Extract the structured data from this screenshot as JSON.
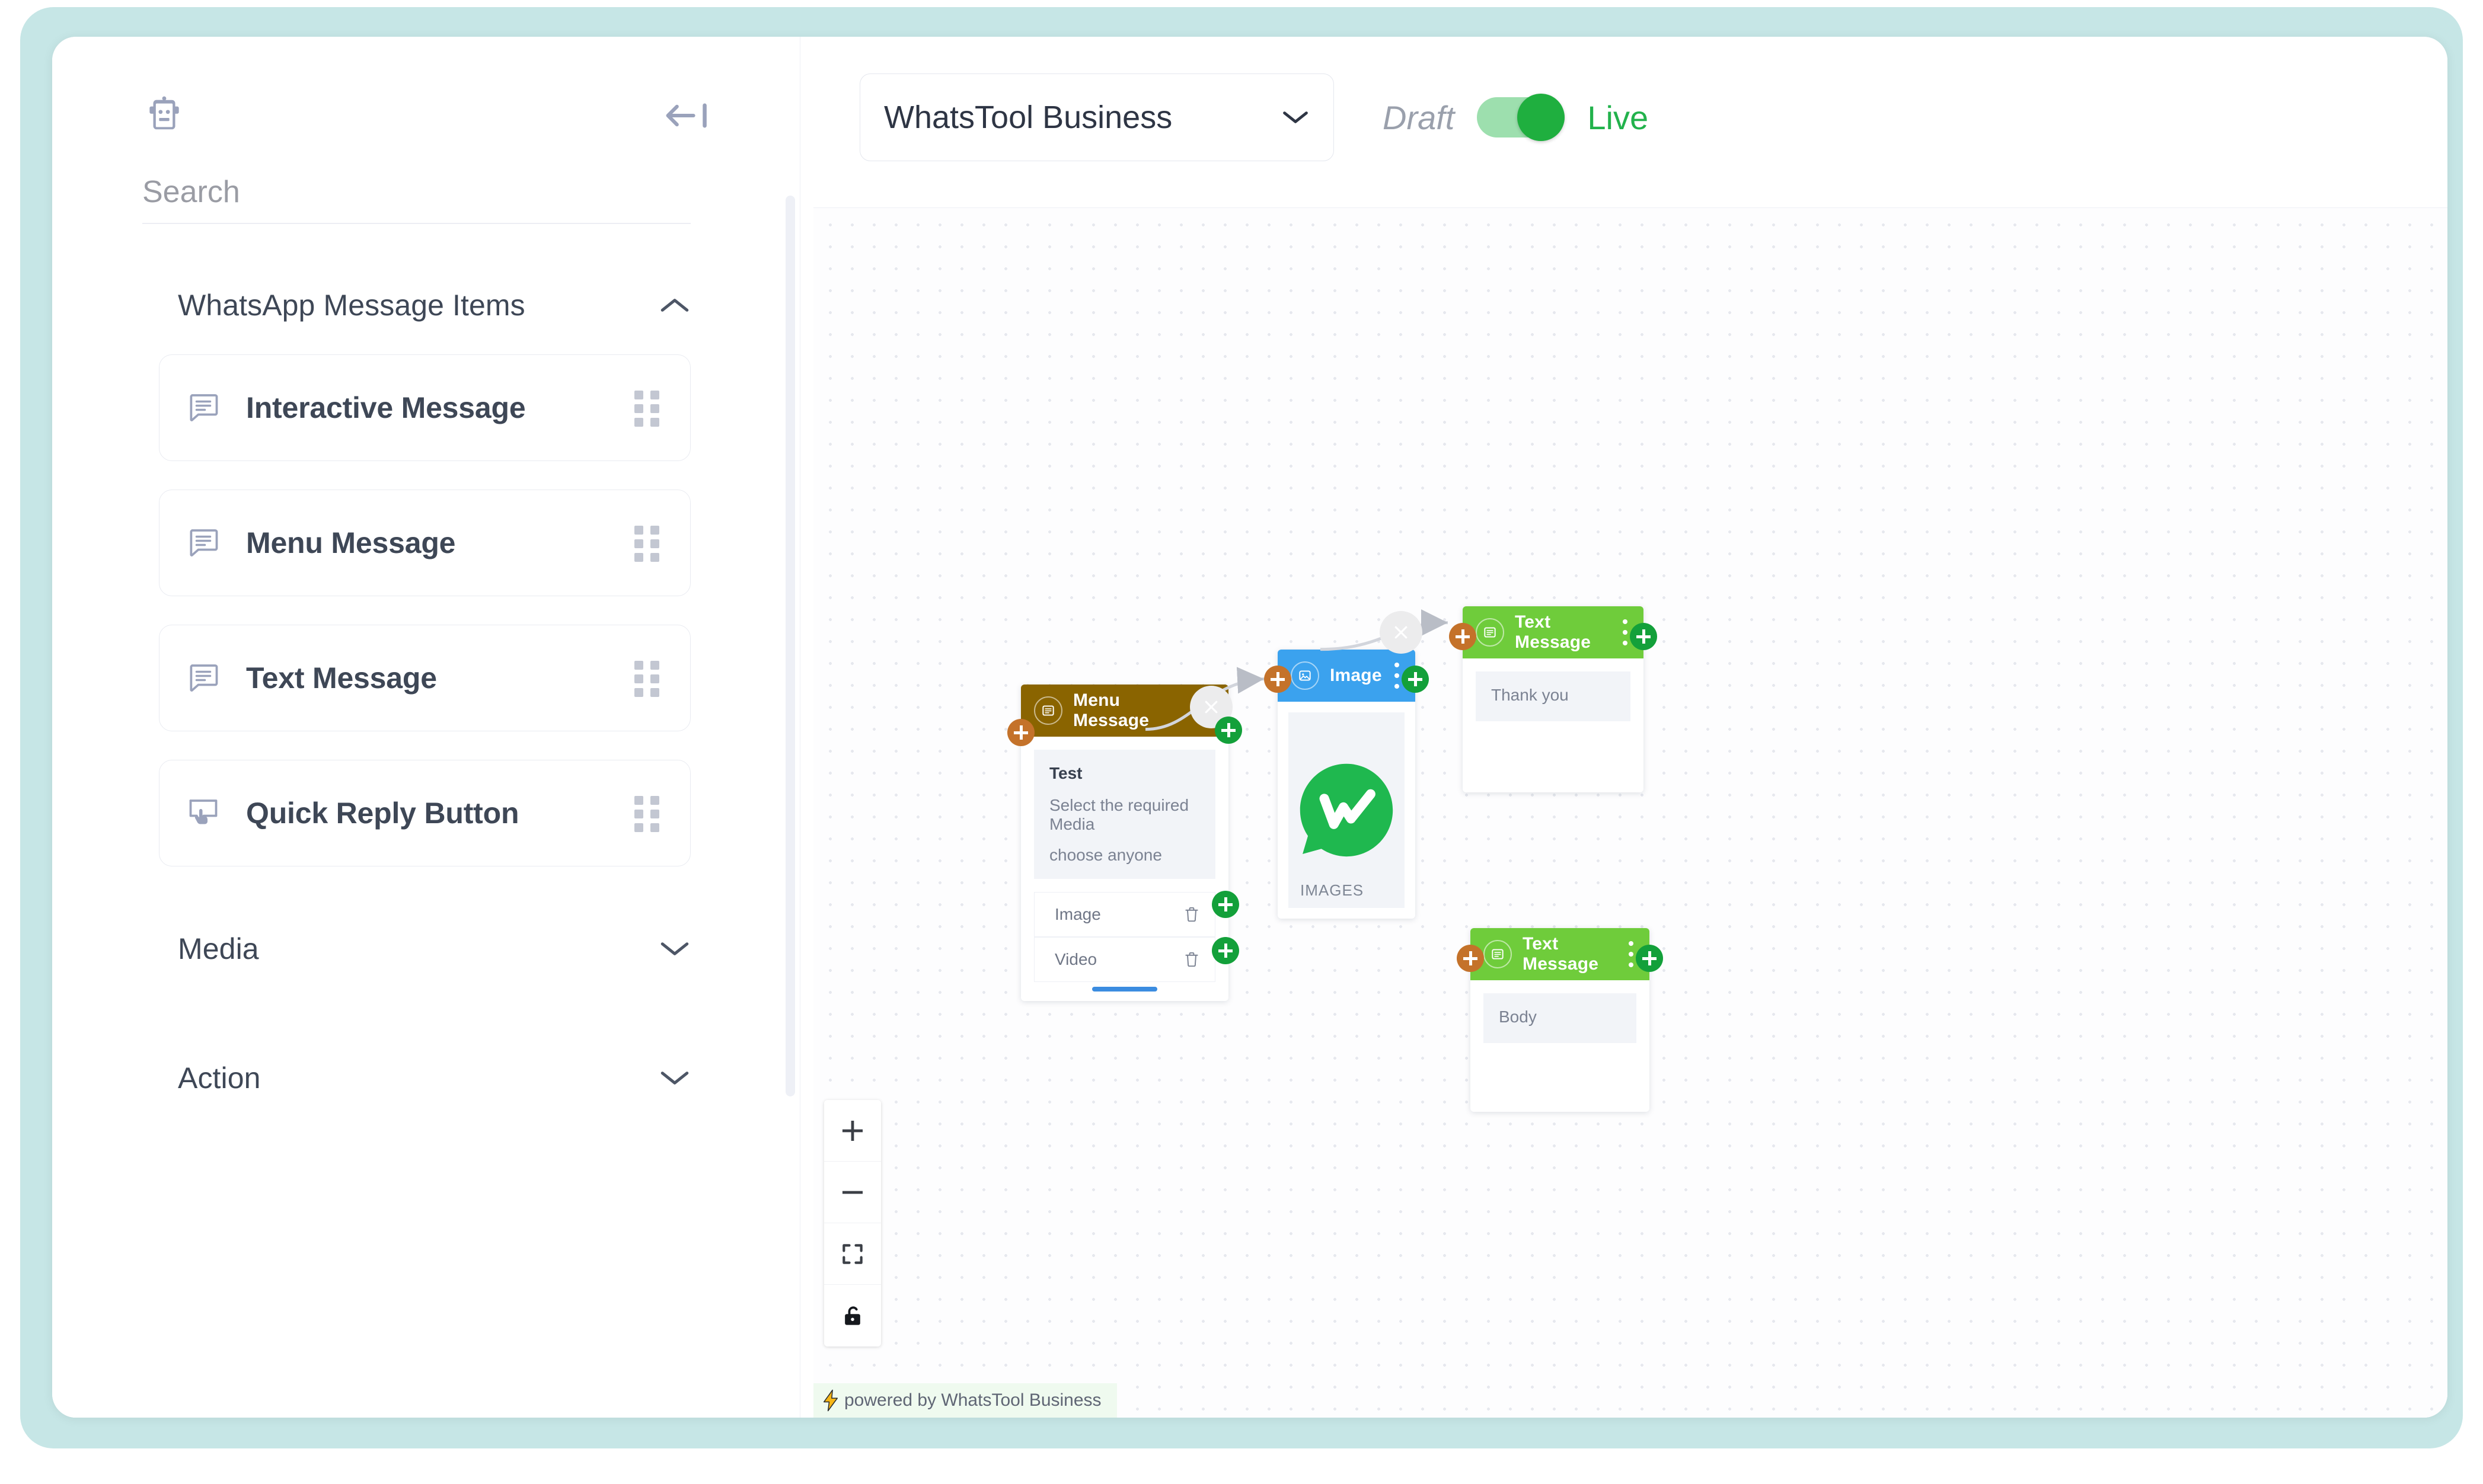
{
  "sidebar": {
    "bot_icon": "robot-icon",
    "collapse_icon": "collapse-panel-icon",
    "search": {
      "placeholder": "Search",
      "value": ""
    },
    "sections": [
      {
        "title": "WhatsApp Message Items",
        "expanded": true,
        "chevron": "chevron-up-icon",
        "items": [
          {
            "label": "Interactive Message",
            "icon": "chat-lines-icon",
            "drag_handle": "drag-grip-icon"
          },
          {
            "label": "Menu Message",
            "icon": "chat-lines-icon",
            "drag_handle": "drag-grip-icon"
          },
          {
            "label": "Text Message",
            "icon": "chat-lines-icon",
            "drag_handle": "drag-grip-icon"
          },
          {
            "label": "Quick Reply Button",
            "icon": "cursor-click-icon",
            "drag_handle": "drag-grip-icon"
          }
        ]
      },
      {
        "title": "Media",
        "expanded": false,
        "chevron": "chevron-down-icon",
        "items": []
      },
      {
        "title": "Action",
        "expanded": false,
        "chevron": "chevron-down-icon",
        "items": []
      }
    ]
  },
  "topbar": {
    "flow_select": {
      "value": "WhatsTool Business",
      "chevron": "chevron-down-icon"
    },
    "status_toggle": {
      "left_label": "Draft",
      "right_label": "Live",
      "state": "Live",
      "on_color": "#1faf3f",
      "track_color": "#9ddfae"
    }
  },
  "canvas": {
    "nodes": [
      {
        "id": "menu-message",
        "title": "Menu Message",
        "header_color": "#8a6400",
        "icon": "menu-message-icon",
        "kebab": "kebab-menu-icon",
        "body": {
          "heading": "Test",
          "lines": [
            "Select the required Media",
            "choose anyone"
          ]
        },
        "options": [
          {
            "label": "Image",
            "delete_icon": "trash-icon"
          },
          {
            "label": "Video",
            "delete_icon": "trash-icon"
          }
        ]
      },
      {
        "id": "image",
        "title": "Image",
        "header_color": "#3ba2ee",
        "icon": "image-icon",
        "kebab": "kebab-menu-icon",
        "preview_logo": "whatstool-logo",
        "caption": "IMAGES"
      },
      {
        "id": "text-message-1",
        "title": "Text Message",
        "header_color": "#6fcc3b",
        "icon": "text-message-icon",
        "kebab": "kebab-menu-icon",
        "body_text": "Thank you"
      },
      {
        "id": "text-message-2",
        "title": "Text Message",
        "header_color": "#6fcc3b",
        "icon": "text-message-icon",
        "kebab": "kebab-menu-icon",
        "body_text": "Body"
      }
    ],
    "edges": [
      {
        "from": "menu-message",
        "to": "image",
        "delete_icon": "edge-delete-icon"
      },
      {
        "from": "image",
        "to": "text-message-1",
        "delete_icon": "edge-delete-icon"
      }
    ],
    "handle_colors": {
      "source": "#13a03a",
      "target": "#c4722a"
    },
    "zoom_controls": [
      {
        "name": "zoom-in",
        "icon": "plus-icon"
      },
      {
        "name": "zoom-out",
        "icon": "minus-icon"
      },
      {
        "name": "fit-view",
        "icon": "fit-view-icon"
      },
      {
        "name": "lock",
        "icon": "lock-icon"
      }
    ],
    "watermark": {
      "text": "powered by WhatsTool Business",
      "icon": "lightning-bolt-icon"
    }
  }
}
